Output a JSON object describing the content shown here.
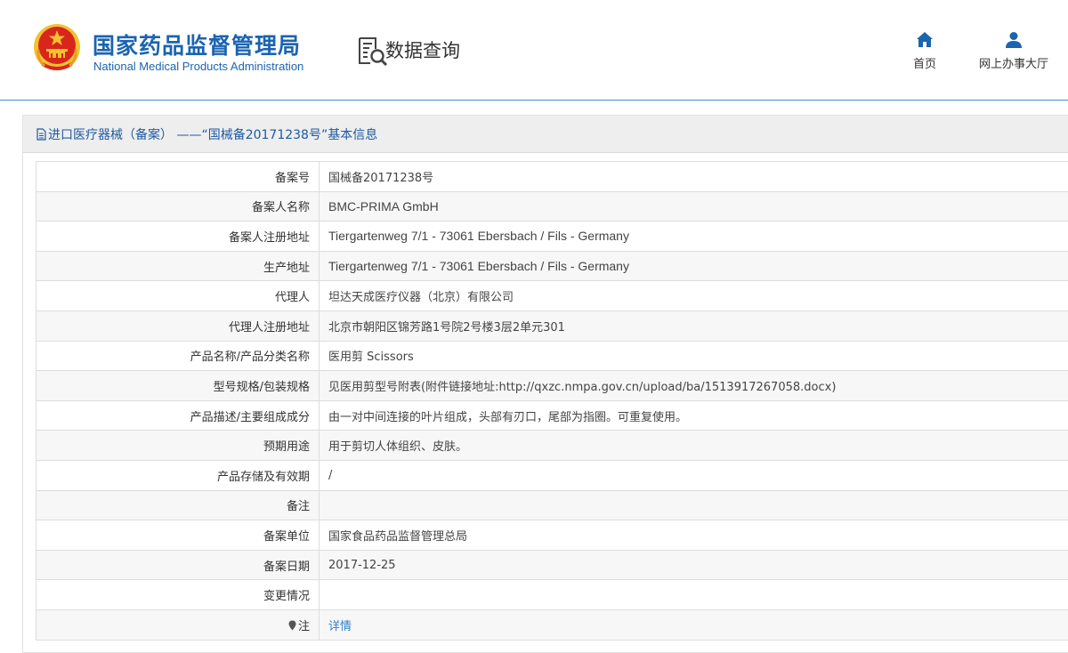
{
  "header": {
    "emblem_icon": "national-emblem-icon",
    "logo_cn": "国家药品监督管理局",
    "logo_en": "National Medical Products Administration",
    "query_icon": "data-query-icon",
    "query_title": "数据查询",
    "nav": [
      {
        "label": "首页",
        "icon": "home-icon"
      },
      {
        "label": "网上办事大厅",
        "icon": "user-icon"
      }
    ]
  },
  "panel": {
    "icon": "document-icon",
    "title": "进口医疗器械（备案） ——“国械备20171238号”基本信息"
  },
  "rows": [
    {
      "label": "备案号",
      "value": "国械备20171238号"
    },
    {
      "label": "备案人名称",
      "value": "BMC-PRIMA GmbH"
    },
    {
      "label": "备案人注册地址",
      "value": "Tiergartenweg 7/1 - 73061 Ebersbach / Fils - Germany"
    },
    {
      "label": "生产地址",
      "value": "Tiergartenweg 7/1 - 73061 Ebersbach / Fils - Germany"
    },
    {
      "label": "代理人",
      "value": "坦达天成医疗仪器（北京）有限公司"
    },
    {
      "label": "代理人注册地址",
      "value": "北京市朝阳区锦芳路1号院2号楼3层2单元301"
    },
    {
      "label": "产品名称/产品分类名称",
      "value": "医用剪 Scissors"
    },
    {
      "label": "型号规格/包装规格",
      "value": "见医用剪型号附表(附件链接地址:http://qxzc.nmpa.gov.cn/upload/ba/1513917267058.docx)"
    },
    {
      "label": "产品描述/主要组成成分",
      "value": "由一对中间连接的叶片组成，头部有刃口，尾部为指圈。可重复使用。"
    },
    {
      "label": "预期用途",
      "value": "用于剪切人体组织、皮肤。"
    },
    {
      "label": "产品存储及有效期",
      "value": "/"
    },
    {
      "label": "备注",
      "value": ""
    },
    {
      "label": "备案单位",
      "value": "国家食品药品监督管理总局"
    },
    {
      "label": "备案日期",
      "value": "2017-12-25"
    },
    {
      "label": "变更情况",
      "value": ""
    },
    {
      "label": "注",
      "value": "详情",
      "icon": "pin-icon"
    }
  ],
  "colors": {
    "brand_blue": "#1b64b0",
    "title_blue": "#1d5aa3",
    "link_blue": "#2f7fc9",
    "emblem_red": "#d8261c",
    "emblem_gold": "#f2c230"
  }
}
